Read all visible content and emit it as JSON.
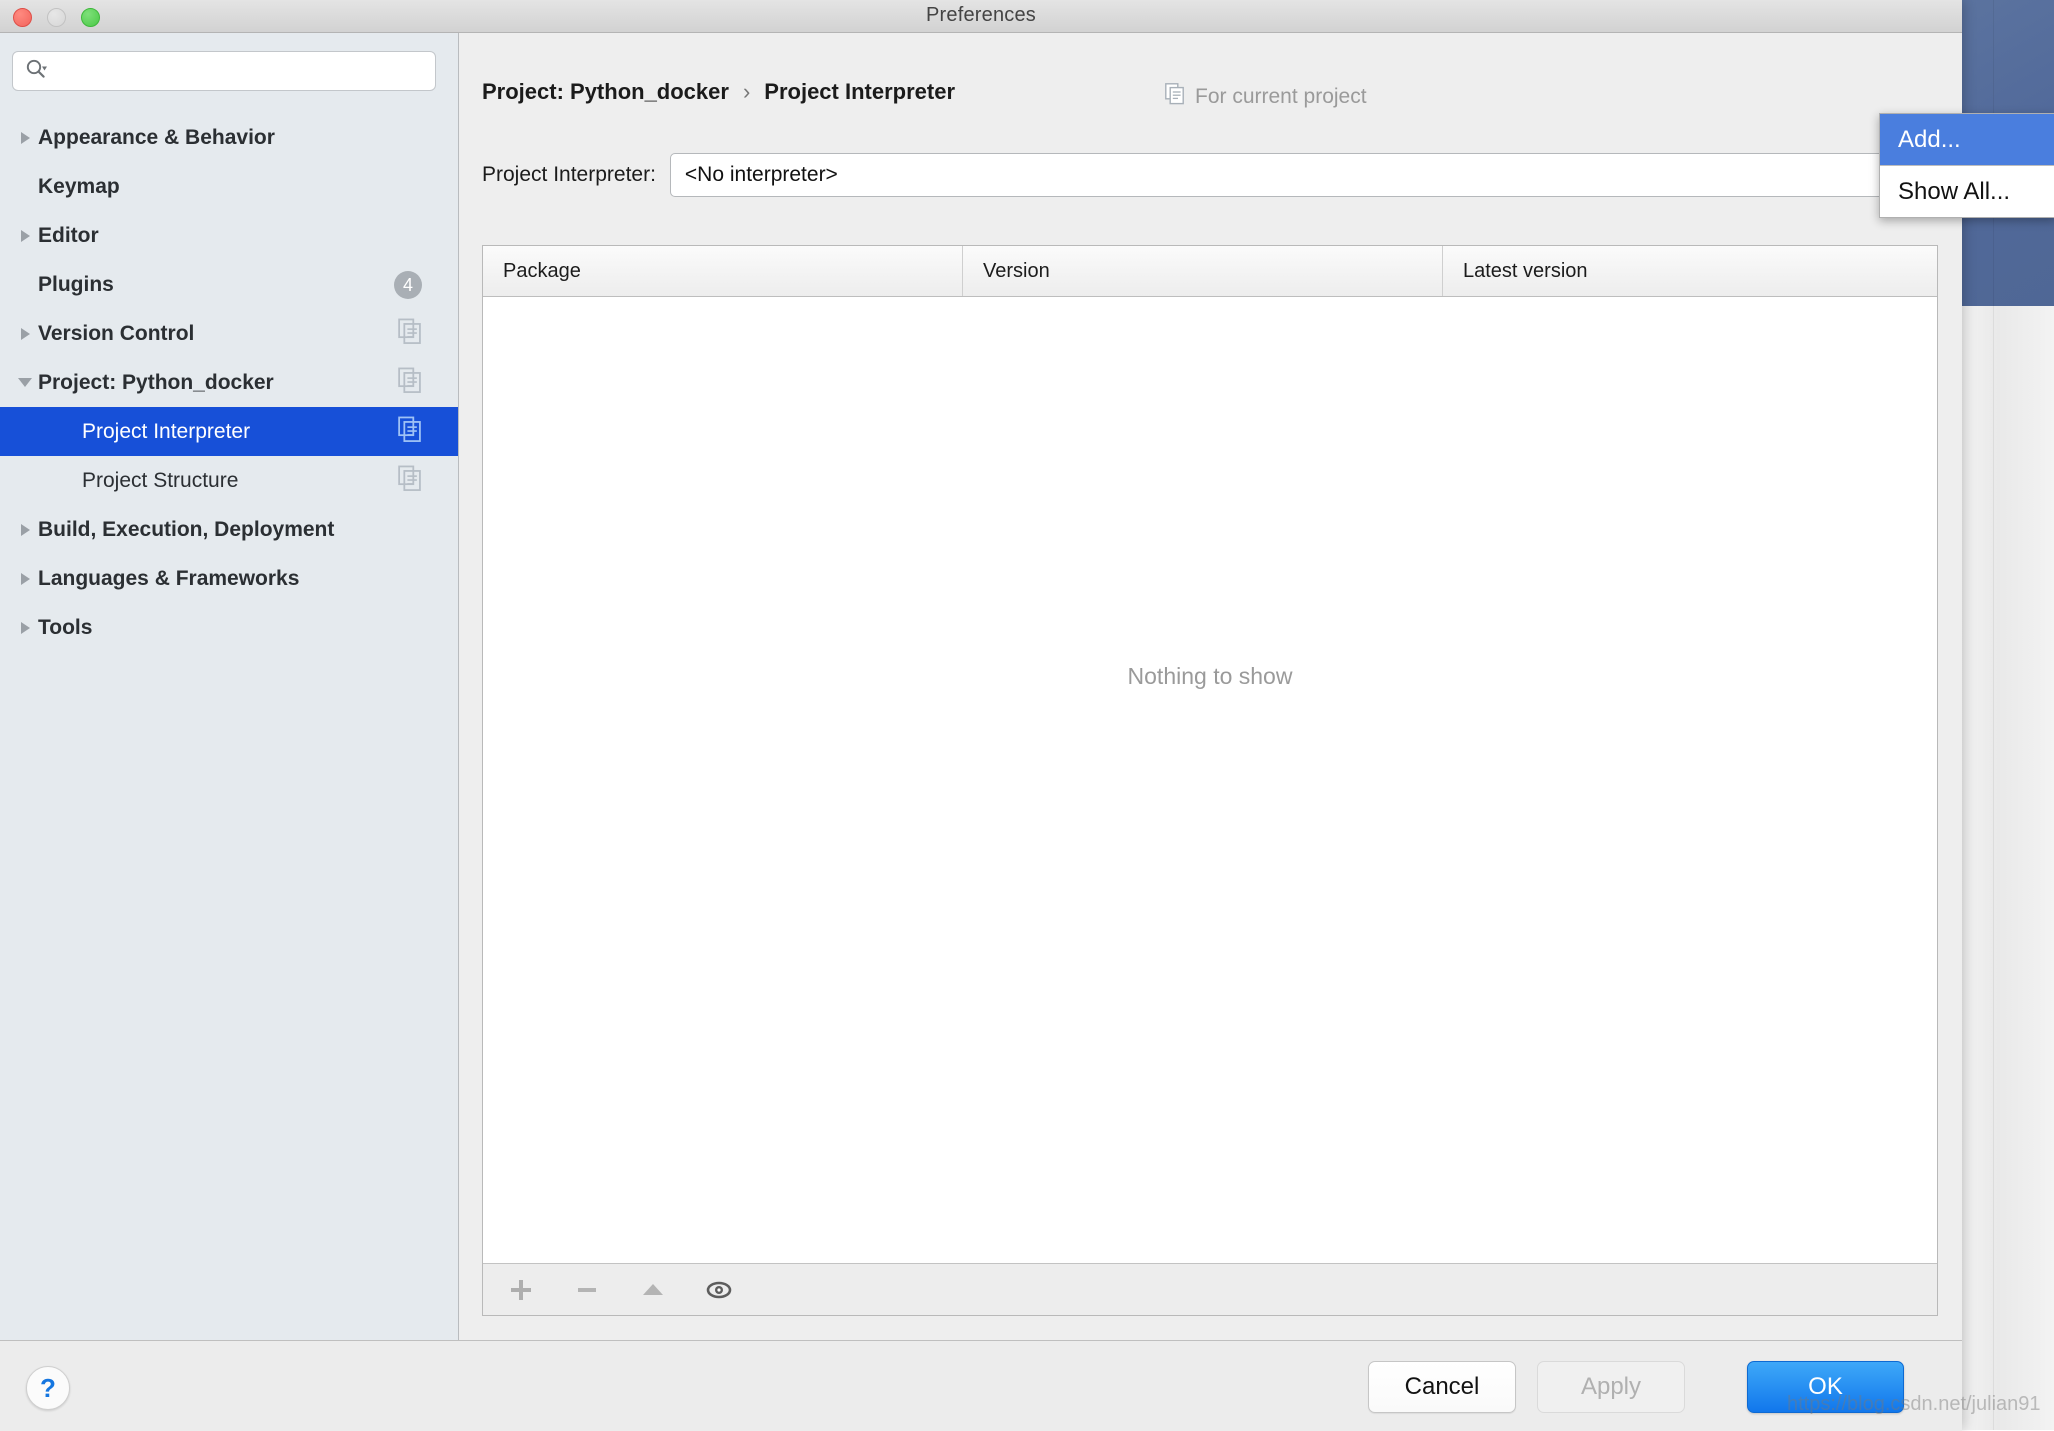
{
  "window": {
    "title": "Preferences",
    "traffic_lights": [
      "close",
      "minimize",
      "zoom"
    ]
  },
  "search": {
    "value": "",
    "placeholder": "",
    "icon": "search-icon"
  },
  "sidebar": {
    "items": [
      {
        "label": "Appearance & Behavior",
        "level": 0,
        "arrow": "collapsed",
        "bold": true,
        "badge": "",
        "copy_icon": false,
        "selected": false
      },
      {
        "label": "Keymap",
        "level": 0,
        "arrow": "none",
        "bold": true,
        "badge": "",
        "copy_icon": false,
        "selected": false
      },
      {
        "label": "Editor",
        "level": 0,
        "arrow": "collapsed",
        "bold": true,
        "badge": "",
        "copy_icon": false,
        "selected": false
      },
      {
        "label": "Plugins",
        "level": 0,
        "arrow": "none",
        "bold": true,
        "badge": "4",
        "copy_icon": false,
        "selected": false
      },
      {
        "label": "Version Control",
        "level": 0,
        "arrow": "collapsed",
        "bold": true,
        "badge": "",
        "copy_icon": true,
        "selected": false
      },
      {
        "label": "Project: Python_docker",
        "level": 0,
        "arrow": "expanded",
        "bold": true,
        "badge": "",
        "copy_icon": true,
        "selected": false
      },
      {
        "label": "Project Interpreter",
        "level": 1,
        "arrow": "none",
        "bold": false,
        "badge": "",
        "copy_icon": true,
        "selected": true
      },
      {
        "label": "Project Structure",
        "level": 1,
        "arrow": "none",
        "bold": false,
        "badge": "",
        "copy_icon": true,
        "selected": false
      },
      {
        "label": "Build, Execution, Deployment",
        "level": 0,
        "arrow": "collapsed",
        "bold": true,
        "badge": "",
        "copy_icon": false,
        "selected": false
      },
      {
        "label": "Languages & Frameworks",
        "level": 0,
        "arrow": "collapsed",
        "bold": true,
        "badge": "",
        "copy_icon": false,
        "selected": false
      },
      {
        "label": "Tools",
        "level": 0,
        "arrow": "collapsed",
        "bold": true,
        "badge": "",
        "copy_icon": false,
        "selected": false
      }
    ]
  },
  "panel": {
    "breadcrumb": {
      "root": "Project: Python_docker",
      "separator": "›",
      "leaf": "Project Interpreter"
    },
    "scope_note": {
      "icon": "copy-scope-icon",
      "text": "For current project"
    },
    "interpreter": {
      "label": "Project Interpreter:",
      "value": "<No interpreter>",
      "stepper_icon": "updown-stepper-icon"
    },
    "table": {
      "columns": [
        "Package",
        "Version",
        "Latest version"
      ],
      "rows": [],
      "empty_text": "Nothing to show"
    },
    "table_toolbar": [
      {
        "icon": "plus-icon",
        "name": "install-package-button"
      },
      {
        "icon": "minus-icon",
        "name": "uninstall-package-button"
      },
      {
        "icon": "upgrade-arrow-icon",
        "name": "upgrade-package-button"
      },
      {
        "icon": "eye-icon",
        "name": "show-early-releases-button"
      }
    ]
  },
  "popup_menu": {
    "items": [
      {
        "label": "Add...",
        "highlighted": true
      },
      {
        "label": "Show All...",
        "highlighted": false
      }
    ]
  },
  "footer": {
    "help_label": "?",
    "cancel_label": "Cancel",
    "apply_label": "Apply",
    "ok_label": "OK"
  },
  "watermark": "https://blog.csdn.net/julian91",
  "colors": {
    "selection_blue": "#1750d8",
    "menu_highlight_blue": "#4a7ede",
    "ok_button_blue": "#1177ec",
    "sidebar_bg": "#e5eaee",
    "panel_bg": "#eeeeee",
    "badge_gray": "#a9afb5",
    "muted_text": "#9a9a9a"
  }
}
